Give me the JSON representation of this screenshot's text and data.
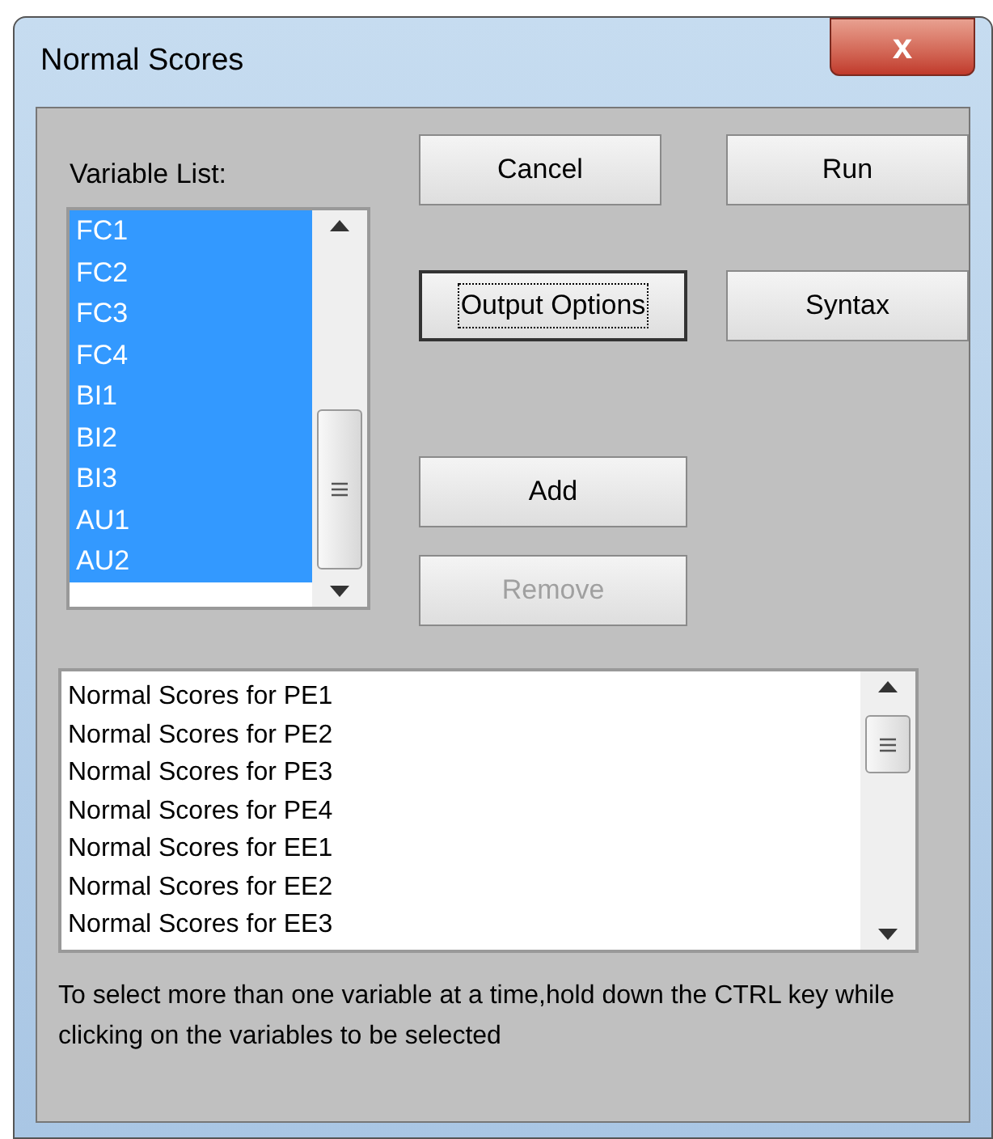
{
  "window": {
    "title": "Normal Scores",
    "close_glyph": "x"
  },
  "variable_list": {
    "label": "Variable List:",
    "items": [
      {
        "text": "FC1",
        "selected": true
      },
      {
        "text": "FC2",
        "selected": true
      },
      {
        "text": "FC3",
        "selected": true
      },
      {
        "text": "FC4",
        "selected": true
      },
      {
        "text": "BI1",
        "selected": true
      },
      {
        "text": "BI2",
        "selected": true
      },
      {
        "text": "BI3",
        "selected": true
      },
      {
        "text": "AU1",
        "selected": true
      },
      {
        "text": "AU2",
        "selected": true
      }
    ]
  },
  "buttons": [
    {
      "label": "Cancel",
      "default": false,
      "disabled": false
    },
    {
      "label": "Run",
      "default": false,
      "disabled": false
    },
    {
      "label": "Output Options",
      "default": true,
      "disabled": false
    },
    {
      "label": "Syntax",
      "default": false,
      "disabled": false
    },
    {
      "label": "Add",
      "default": false,
      "disabled": false
    },
    {
      "label": "Remove",
      "default": false,
      "disabled": true
    }
  ],
  "output_list": {
    "items": [
      "Normal Scores for PE1",
      "Normal Scores for PE2",
      "Normal Scores for PE3",
      "Normal Scores for PE4",
      "Normal Scores for EE1",
      "Normal Scores for EE2",
      "Normal Scores for EE3"
    ]
  },
  "hint": "To select more than one variable at a time,hold down the CTRL key while clicking on the variables to be selected"
}
